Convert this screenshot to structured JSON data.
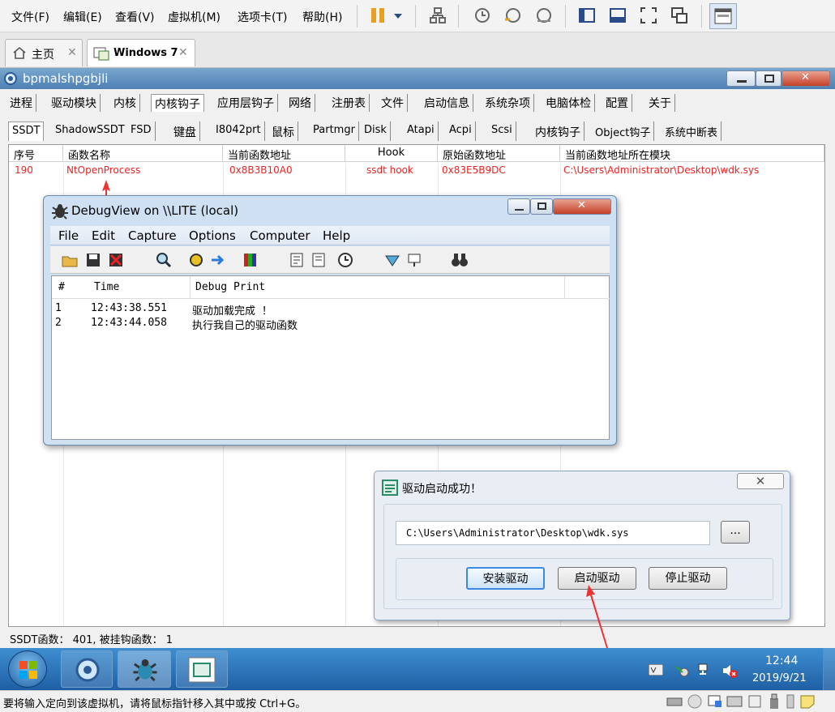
{
  "host_menu": {
    "items": [
      "文件(F)",
      "编辑(E)",
      "查看(V)",
      "虚拟机(M)",
      "选项卡(T)",
      "帮助(H)"
    ]
  },
  "host_tabs": {
    "home": "主页",
    "vm": "Windows 7"
  },
  "guest_window": {
    "title": "bpmalshpgbjli",
    "main_tabs": [
      "进程",
      "驱动模块",
      "内核",
      "内核钩子",
      "应用层钩子",
      "网络",
      "注册表",
      "文件",
      "启动信息",
      "系统杂项",
      "电脑体检",
      "配置",
      "关于"
    ],
    "sub_tabs": [
      "SSDT",
      "ShadowSSDT",
      "FSD",
      "键盘",
      "I8042prt",
      "鼠标",
      "Partmgr",
      "Disk",
      "Atapi",
      "Acpi",
      "Scsi",
      "内核钩子",
      "Object钩子",
      "系统中断表"
    ],
    "columns": [
      "序号",
      "函数名称",
      "当前函数地址",
      "Hook",
      "原始函数地址",
      "当前函数地址所在模块"
    ],
    "rows": [
      [
        "190",
        "NtOpenProcess",
        "0x8B3B10A0",
        "ssdt hook",
        "0x83E5B9DC",
        "C:\\Users\\Administrator\\Desktop\\wdk.sys"
      ]
    ],
    "status": "SSDT函数： 401, 被挂钩函数： 1"
  },
  "debugview": {
    "title": "DebugView on \\\\LITE (local)",
    "menu": [
      "File",
      "Edit",
      "Capture",
      "Options",
      "Computer",
      "Help"
    ],
    "columns": [
      "#",
      "Time",
      "Debug Print"
    ],
    "rows": [
      [
        "1",
        "12:43:38.551",
        "驱动加载完成 ！"
      ],
      [
        "2",
        "12:43:44.058",
        "执行我自己的驱动函数"
      ]
    ]
  },
  "driver_dialog": {
    "title": "驱动启动成功！",
    "path": "C:\\Users\\Administrator\\Desktop\\wdk.sys",
    "browse": "...",
    "install": "安装驱动",
    "start": "启动驱动",
    "stop": "停止驱动"
  },
  "taskbar": {
    "time": "12:44",
    "date": "2019/9/21"
  },
  "host_status": "要将输入定向到该虚拟机，请将鼠标指针移入其中或按 Ctrl+G。",
  "colors": {
    "hook_red": "#e22222",
    "arrow_red": "#ee3333",
    "taskbar_blue": "#2a6fb5"
  }
}
